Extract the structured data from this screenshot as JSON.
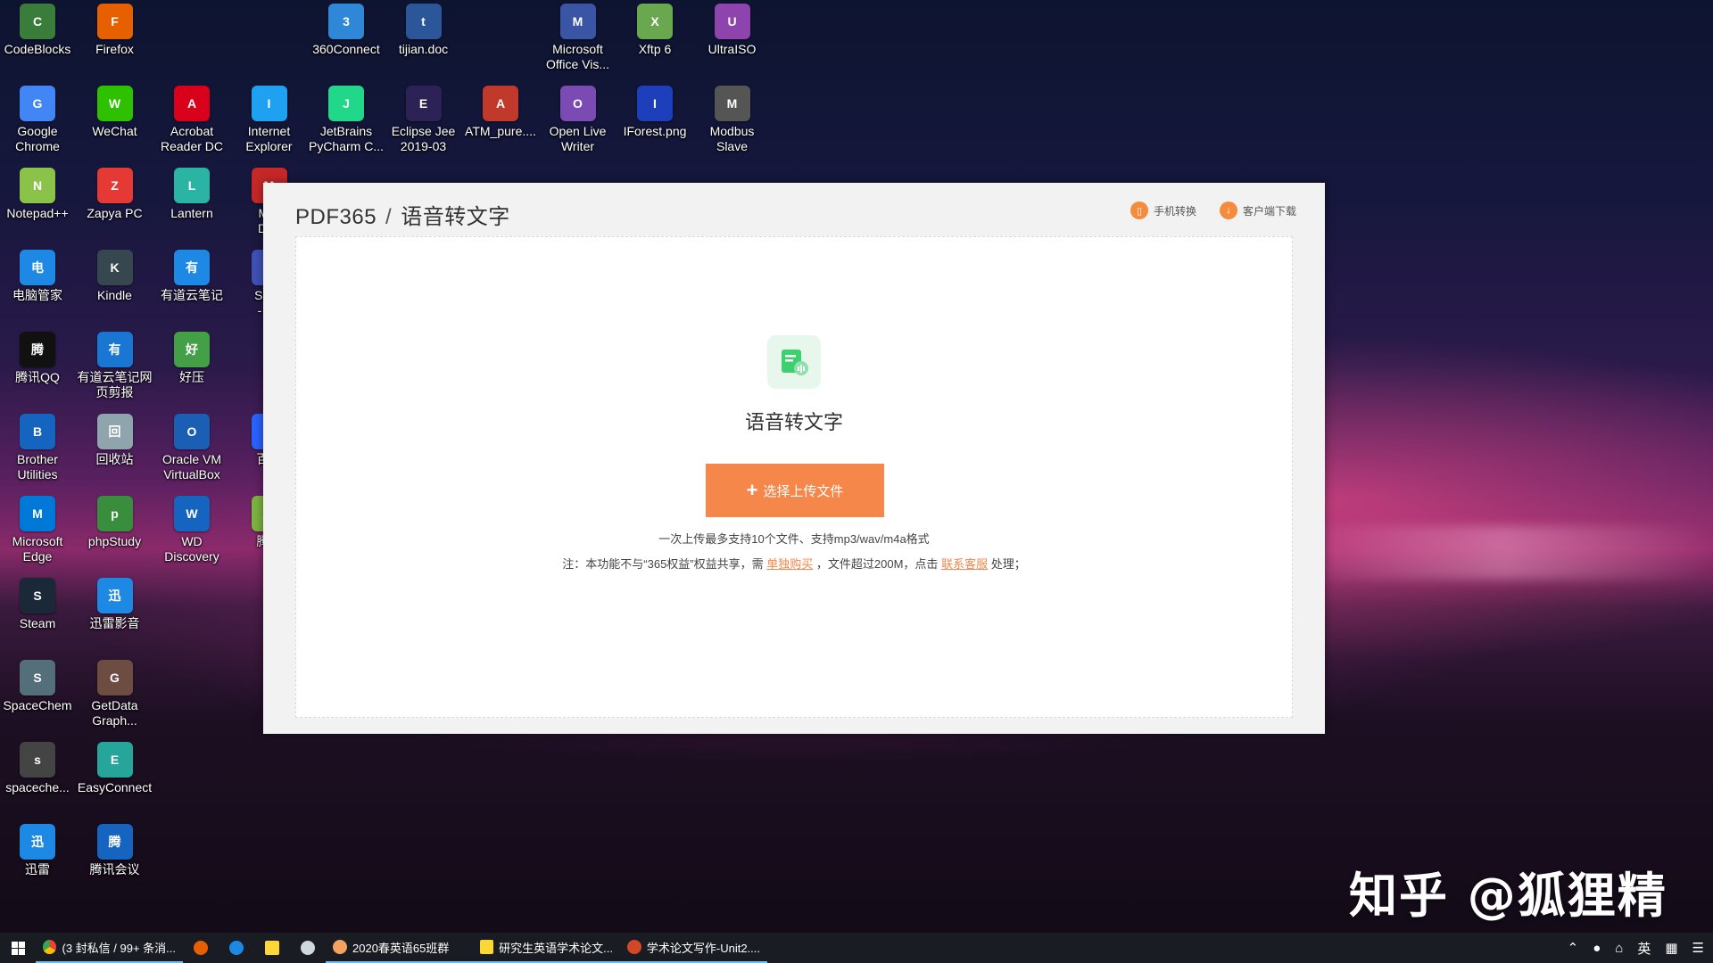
{
  "desktop": {
    "icons": [
      {
        "label": "CodeBlocks",
        "icon": "codeblocks-icon",
        "color": "#3a7d3a"
      },
      {
        "label": "Firefox",
        "icon": "firefox-icon",
        "color": "#e66000"
      },
      {
        "label": "360Connect",
        "icon": "360connect-icon",
        "color": "#2f87d8"
      },
      {
        "label": "tijian.doc",
        "icon": "word-document-icon",
        "color": "#2b579a"
      },
      {
        "label": "Microsoft\nOffice Vis...",
        "icon": "visio-icon",
        "color": "#3955a3"
      },
      {
        "label": "Xftp 6",
        "icon": "xftp-icon",
        "color": "#6aa84f"
      },
      {
        "label": "UltraISO",
        "icon": "ultraiso-icon",
        "color": "#8e44ad"
      },
      {
        "label": "Google\nChrome",
        "icon": "chrome-icon",
        "color": "#4285f4"
      },
      {
        "label": "WeChat",
        "icon": "wechat-icon",
        "color": "#2dc100"
      },
      {
        "label": "Acrobat\nReader DC",
        "icon": "acrobat-icon",
        "color": "#d9001b"
      },
      {
        "label": "Internet\nExplorer",
        "icon": "ie-icon",
        "color": "#1ea1f1"
      },
      {
        "label": "JetBrains\nPyCharm C...",
        "icon": "pycharm-icon",
        "color": "#21d789"
      },
      {
        "label": "Eclipse Jee\n2019-03",
        "icon": "eclipse-icon",
        "color": "#2c2255"
      },
      {
        "label": "ATM_pure....",
        "icon": "archive-icon",
        "color": "#c0392b"
      },
      {
        "label": "Open Live\nWriter",
        "icon": "live-writer-icon",
        "color": "#7b4bb3"
      },
      {
        "label": "IForest.png",
        "icon": "image-file-icon",
        "color": "#1d3fbb"
      },
      {
        "label": "Modbus\nSlave",
        "icon": "modbus-icon",
        "color": "#555555"
      },
      {
        "label": "Notepad++",
        "icon": "notepadpp-icon",
        "color": "#8bc34a"
      },
      {
        "label": "Zapya PC",
        "icon": "zapya-icon",
        "color": "#e53935"
      },
      {
        "label": "Lantern",
        "icon": "lantern-icon",
        "color": "#2bb3a3"
      },
      {
        "label": "Mer\nDes",
        "icon": "app-icon",
        "color": "#c62828"
      },
      {
        "label": "电脑管家",
        "icon": "pc-manager-icon",
        "color": "#1e88e5"
      },
      {
        "label": "Kindle",
        "icon": "kindle-icon",
        "color": "#37474f"
      },
      {
        "label": "有道云笔记",
        "icon": "youdao-note-icon",
        "color": "#1e88e5"
      },
      {
        "label": "Shad\n- Sh",
        "icon": "app-icon",
        "color": "#3f51b5"
      },
      {
        "label": "腾讯QQ",
        "icon": "qq-icon",
        "color": "#111111"
      },
      {
        "label": "有道云笔记网\n页剪报",
        "icon": "youdao-clipper-icon",
        "color": "#1976d2"
      },
      {
        "label": "好压",
        "icon": "haozip-icon",
        "color": "#43a047"
      },
      {
        "label": "Brother\nUtilities",
        "icon": "brother-icon",
        "color": "#1565c0"
      },
      {
        "label": "回收站",
        "icon": "recycle-bin-icon",
        "color": "#90a4ae"
      },
      {
        "label": "Oracle VM\nVirtualBox",
        "icon": "virtualbox-icon",
        "color": "#1a5fb4"
      },
      {
        "label": "百度",
        "icon": "app-icon",
        "color": "#2962ff"
      },
      {
        "label": "Microsoft\nEdge",
        "icon": "edge-icon",
        "color": "#0078d7"
      },
      {
        "label": "phpStudy",
        "icon": "phpstudy-icon",
        "color": "#388e3c"
      },
      {
        "label": "WD\nDiscovery",
        "icon": "wd-icon",
        "color": "#1565c0"
      },
      {
        "label": "腾讯",
        "icon": "app-icon",
        "color": "#7cb342"
      },
      {
        "label": "Steam",
        "icon": "steam-icon",
        "color": "#1b2838"
      },
      {
        "label": "迅雷影音",
        "icon": "xunlei-player-icon",
        "color": "#1e88e5"
      },
      {
        "label": "SpaceChem",
        "icon": "spacechem-icon",
        "color": "#546e7a"
      },
      {
        "label": "GetData\nGraph...",
        "icon": "getdata-icon",
        "color": "#6d4c41"
      },
      {
        "label": "spaceche...",
        "icon": "shortcut-icon",
        "color": "#444444"
      },
      {
        "label": "EasyConnect",
        "icon": "easyconnect-icon",
        "color": "#26a69a"
      },
      {
        "label": "迅雷",
        "icon": "xunlei-icon",
        "color": "#1e88e5"
      },
      {
        "label": "腾讯会议",
        "icon": "tencent-meeting-icon",
        "color": "#1565c0"
      }
    ]
  },
  "window": {
    "brand": "PDF365",
    "separator": "/",
    "page": "语音转文字",
    "links": {
      "mobile": "手机转换",
      "client": "客户端下载"
    },
    "feature_title": "语音转文字",
    "upload_button": "选择上传文件",
    "upload_plus": "+",
    "hint1": "一次上传最多支持10个文件、支持mp3/wav/m4a格式",
    "hint2_prefix": "注：本功能不与“365权益”权益共享，需",
    "hint2_link1": "单独购买",
    "hint2_middle": "，文件超过200M，点击",
    "hint2_link2": "联系客服",
    "hint2_suffix": "处理；",
    "accent": "#f5874a"
  },
  "watermark": "知乎 @狐狸精",
  "taskbar": {
    "items": [
      {
        "label": "(3 封私信 / 99+ 条消...",
        "icon": "chrome-icon"
      },
      {
        "label": "2020春英语65班群",
        "icon": "chat-group-icon"
      },
      {
        "label": "研究生英语学术论文...",
        "icon": "file-icon"
      },
      {
        "label": "学术论文写作-Unit2....",
        "icon": "powerpoint-icon"
      }
    ],
    "ime": "英"
  }
}
